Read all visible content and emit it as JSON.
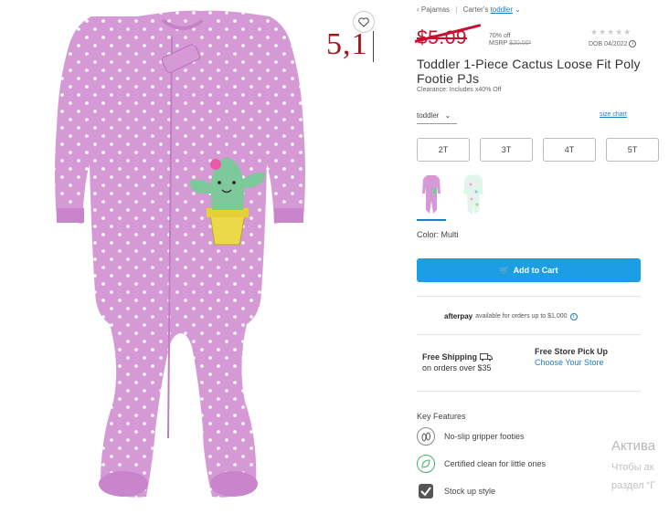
{
  "annotation": {
    "text": "5,1"
  },
  "breadcrumb": {
    "prefix": "‹",
    "item1": "Pajamas",
    "sep": "|",
    "item2": "Carter's",
    "item3": "toddler",
    "chev": "⌄"
  },
  "price": {
    "old": "$5.09",
    "pct_off": "70% off",
    "msrp_label": "MSRP",
    "msrp_value": "$20.00*"
  },
  "rating": {
    "stars": "★★★★★",
    "dob": "DOB 04/2022"
  },
  "product": {
    "title": "Toddler 1-Piece Cactus Loose Fit Poly Footie PJs",
    "clearance": "Clearance: Includes x40% Off"
  },
  "size": {
    "selector_value": "toddler",
    "size_chart_label": "size chart",
    "options": [
      "2T",
      "3T",
      "4T",
      "5T"
    ]
  },
  "color": {
    "label": "Color: Multi"
  },
  "cart": {
    "label": "Add to Cart"
  },
  "afterpay": {
    "brand": "afterpay",
    "text": "available for orders up to $1,000"
  },
  "shipping": {
    "title": "Free Shipping",
    "sub": "on orders over $35"
  },
  "pickup": {
    "title": "Free Store Pick Up",
    "link": "Choose Your Store"
  },
  "features": {
    "title": "Key Features",
    "items": [
      {
        "label": "No-slip gripper footies",
        "icon": "footprint-icon"
      },
      {
        "label": "Certified clean for little ones",
        "icon": "leaf-icon"
      },
      {
        "label": "Stock up style",
        "icon": "check-icon"
      }
    ]
  },
  "windows_activation": {
    "title": "Актива",
    "line1": "Чтобы ак",
    "line2": "раздел “Г"
  },
  "colors": {
    "accent": "#1b9ee3",
    "sale": "#c8102e",
    "garment": "#d59ad6",
    "cactus": "#7ec99b",
    "pot": "#ecd94a"
  }
}
